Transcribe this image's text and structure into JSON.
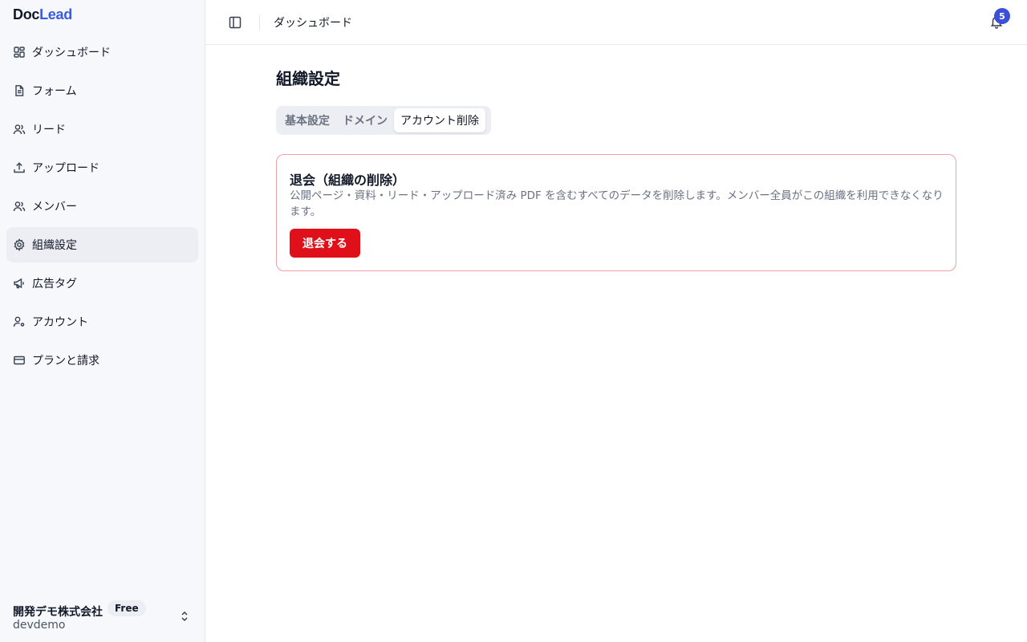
{
  "brand": {
    "part1": "Doc",
    "part2": "Lead"
  },
  "sidebar": {
    "items": [
      {
        "label": "ダッシュボード",
        "icon": "dashboard-icon"
      },
      {
        "label": "フォーム",
        "icon": "file-text-icon"
      },
      {
        "label": "リード",
        "icon": "users-icon"
      },
      {
        "label": "アップロード",
        "icon": "upload-icon"
      },
      {
        "label": "メンバー",
        "icon": "users-icon"
      },
      {
        "label": "組織設定",
        "icon": "gear-icon",
        "active": true
      },
      {
        "label": "広告タグ",
        "icon": "megaphone-icon"
      },
      {
        "label": "アカウント",
        "icon": "user-cog-icon"
      },
      {
        "label": "プランと請求",
        "icon": "credit-card-icon"
      }
    ],
    "org": {
      "name": "開発デモ株式会社",
      "plan": "Free",
      "slug": "devdemo"
    }
  },
  "header": {
    "breadcrumb": "ダッシュボード",
    "notification_count": "5"
  },
  "main": {
    "title": "組織設定",
    "tabs": [
      {
        "label": "基本設定"
      },
      {
        "label": "ドメイン"
      },
      {
        "label": "アカウント削除",
        "active": true
      }
    ],
    "danger": {
      "title": "退会（組織の削除）",
      "description": "公開ページ・資料・リード・アップロード済み PDF を含むすべてのデータを削除します。メンバー全員がこの組織を利用できなくなります。",
      "button_label": "退会する"
    }
  },
  "colors": {
    "accent": "#3b5bdb",
    "badge": "#3b4fd8",
    "danger": "#e0101a",
    "danger_border": "#f0a0a6",
    "sidebar_bg": "#f7f8fc"
  }
}
